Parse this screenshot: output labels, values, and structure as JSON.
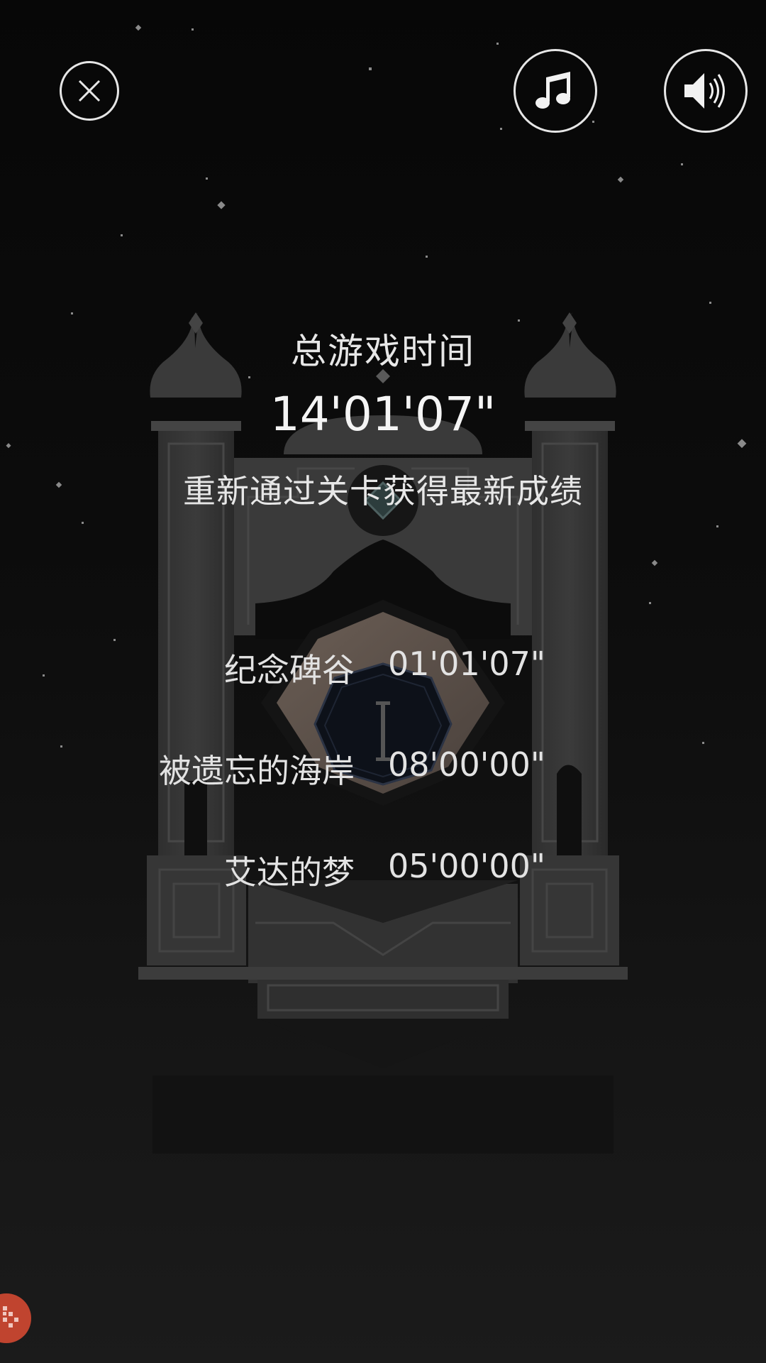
{
  "header": {
    "close_icon": "close-icon",
    "music_icon": "music-note-icon",
    "sound_icon": "speaker-icon"
  },
  "summary": {
    "title": "总游戏时间",
    "total_time": "14'01'07\"",
    "subtitle": "重新通过关卡获得最新成绩"
  },
  "levels": [
    {
      "name": "纪念碑谷",
      "time": "01'01'07\""
    },
    {
      "name": "被遗忘的海岸",
      "time": "08'00'00\""
    },
    {
      "name": "艾达的梦",
      "time": "05'00'00\""
    }
  ],
  "colors": {
    "background": "#0a0a0a",
    "text": "#e7e7e7",
    "monument": "#3a3a3a",
    "badge": "#c0442f"
  }
}
